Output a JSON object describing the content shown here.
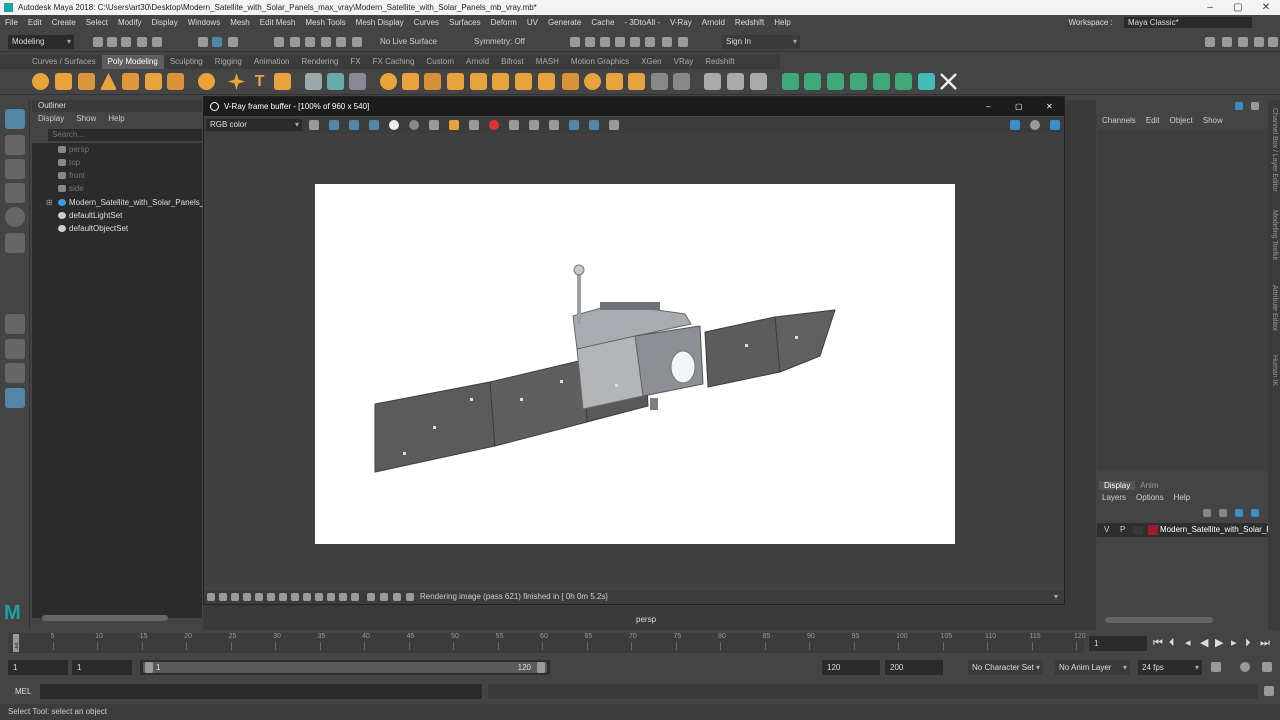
{
  "window": {
    "title": "Autodesk Maya 2018: C:\\Users\\art30\\Desktop\\Modern_Satellite_with_Solar_Panels_max_vray\\Modern_Satellite_with_Solar_Panels_mb_vray.mb*",
    "minimize": "–",
    "maximize": "▢",
    "close": "✕"
  },
  "menu": {
    "items": [
      "File",
      "Edit",
      "Create",
      "Select",
      "Modify",
      "Display",
      "Windows",
      "Mesh",
      "Edit Mesh",
      "Mesh Tools",
      "Mesh Display",
      "Curves",
      "Surfaces",
      "Deform",
      "UV",
      "Generate",
      "Cache",
      "- 3DtoAll -",
      "V-Ray",
      "Arnold",
      "Redshift",
      "Help"
    ],
    "workspace_label": "Workspace :",
    "workspace_value": "Maya Classic*"
  },
  "status_line": {
    "mode": "Modeling",
    "live_surface": "No Live Surface",
    "symmetry": "Symmetry: Off",
    "sign_in": "Sign In"
  },
  "shelf": {
    "tabs": [
      "Curves / Surfaces",
      "Poly Modeling",
      "Sculpting",
      "Rigging",
      "Animation",
      "Rendering",
      "FX",
      "FX Caching",
      "Custom",
      "Arnold",
      "Bifrost",
      "MASH",
      "Motion Graphics",
      "XGen",
      "VRay",
      "Redshift"
    ],
    "active_tab": "Poly Modeling"
  },
  "outliner": {
    "title": "Outliner",
    "menu": [
      "Display",
      "Show",
      "Help"
    ],
    "search_placeholder": "Search...",
    "items": [
      {
        "label": "persp",
        "icon": "camera-icon",
        "dim": true
      },
      {
        "label": "top",
        "icon": "camera-icon",
        "dim": true
      },
      {
        "label": "front",
        "icon": "camera-icon",
        "dim": true
      },
      {
        "label": "side",
        "icon": "camera-icon",
        "dim": true
      },
      {
        "label": "Modern_Satellite_with_Solar_Panels_",
        "icon": "group-icon",
        "dim": false
      },
      {
        "label": "defaultLightSet",
        "icon": "set-icon",
        "dim": false
      },
      {
        "label": "defaultObjectSet",
        "icon": "set-icon",
        "dim": false
      }
    ]
  },
  "vray": {
    "title": "V-Ray frame buffer - [100% of 960 x 540]",
    "channel": "RGB color",
    "status": "Rendering image (pass 621) finished in [ 0h  0m  5.2s]"
  },
  "viewport": {
    "camera_label": "persp"
  },
  "channel_box": {
    "menu": [
      "Channels",
      "Edit",
      "Object",
      "Show"
    ],
    "side_tabs": [
      "Channel Box / Layer Editor",
      "Modeling Toolkit",
      "Attribute Editor",
      "Human IK"
    ]
  },
  "layer_editor": {
    "tabs": [
      "Display",
      "Anim"
    ],
    "menu": [
      "Layers",
      "Options",
      "Help"
    ],
    "layer": {
      "v": "V",
      "p": "P",
      "name": "Modern_Satellite_with_Solar_P",
      "color": "#9b1b30"
    }
  },
  "timeline": {
    "ticks": [
      "1",
      "5",
      "10",
      "15",
      "20",
      "25",
      "30",
      "35",
      "40",
      "45",
      "50",
      "55",
      "60",
      "65",
      "70",
      "75",
      "80",
      "85",
      "90",
      "95",
      "100",
      "105",
      "110",
      "115",
      "120"
    ],
    "current_frame": "1"
  },
  "range": {
    "start": "1",
    "anim_start": "1",
    "slider_start": "1",
    "slider_end": "120",
    "end": "120",
    "anim_end": "200",
    "character_set": "No Character Set",
    "anim_layer": "No Anim Layer",
    "fps": "24 fps"
  },
  "command_line": {
    "label": "MEL"
  },
  "help_line": {
    "text": "Select Tool: select an object"
  },
  "colors": {
    "accent_blue": "#5285a6",
    "maya_teal": "#1aa3a3",
    "shelf_orange": "#e8a33c",
    "shelf_green": "#3ea87a"
  }
}
